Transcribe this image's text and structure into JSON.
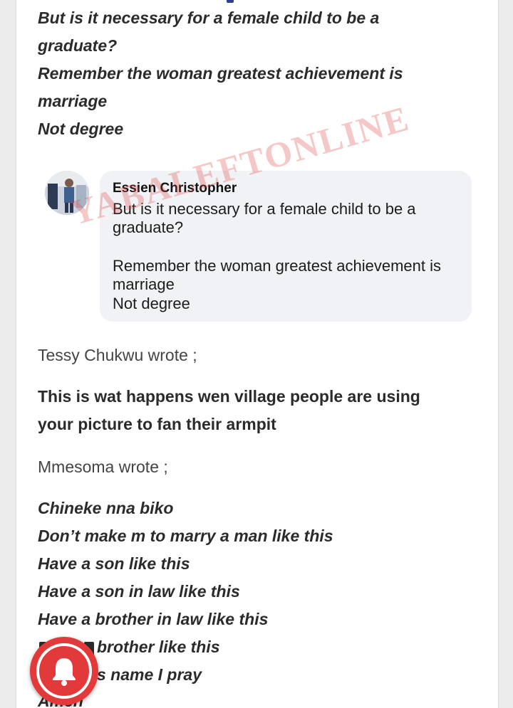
{
  "post_lines": [
    "But is it necessary for a female child to be a",
    "graduate?",
    "Remember the woman greatest achievement is",
    "marriage",
    "Not degree"
  ],
  "embedded_comment": {
    "author": "Essien Christopher",
    "lines": [
      "But is it necessary for a female child to be a",
      "graduate?",
      "Remember the woman greatest achievement is",
      "marriage",
      "Not degree"
    ],
    "watermark": "YABALEFTONLINE"
  },
  "wrote_1": "Tessy Chukwu wrote ;",
  "quote_1": [
    "This is wat happens wen village people are using",
    "your picture to fan their armpit"
  ],
  "wrote_2": "Mmesoma wrote ;",
  "quote_2": [
    "Chineke nna biko",
    "Don’t make m to marry a man like this",
    "Have a son like this",
    "Have a son in law like this",
    "Have a brother in law like this",
    "brother like this",
    "s name I pray",
    "Amen"
  ],
  "icons": {
    "notification": "bell-icon"
  },
  "colors": {
    "notification_button": "#e23a3a"
  }
}
